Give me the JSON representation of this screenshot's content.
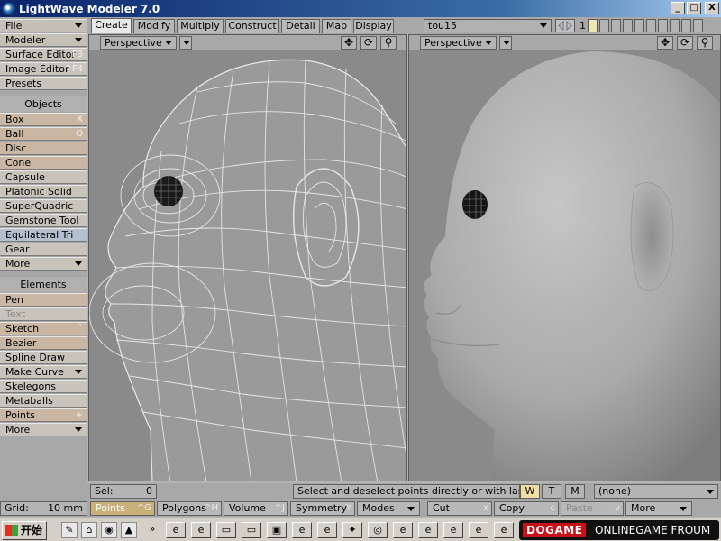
{
  "window": {
    "title": "LightWave Modeler 7.0",
    "controls": [
      "_",
      "□",
      "X"
    ]
  },
  "toolpanel": {
    "top_buttons": [
      {
        "label": "File",
        "shortcut": "",
        "dropdown": true,
        "style": "hdr"
      },
      {
        "label": "Modeler",
        "shortcut": "",
        "dropdown": true,
        "style": "hdr"
      },
      {
        "label": "Surface Editor",
        "shortcut": "F3",
        "dropdown": false,
        "style": ""
      },
      {
        "label": "Image Editor",
        "shortcut": "^F4",
        "dropdown": false,
        "style": ""
      },
      {
        "label": "Presets",
        "shortcut": "",
        "dropdown": false,
        "style": ""
      }
    ],
    "objects_header": "Objects",
    "objects": [
      {
        "label": "Box",
        "shortcut": "X",
        "dropdown": false,
        "style": "tan"
      },
      {
        "label": "Ball",
        "shortcut": "O",
        "dropdown": false,
        "style": "tan"
      },
      {
        "label": "Disc",
        "shortcut": "",
        "dropdown": false,
        "style": "tan"
      },
      {
        "label": "Cone",
        "shortcut": "",
        "dropdown": false,
        "style": "tan"
      },
      {
        "label": "Capsule",
        "shortcut": "",
        "dropdown": false,
        "style": ""
      },
      {
        "label": "Platonic Solid",
        "shortcut": "",
        "dropdown": false,
        "style": ""
      },
      {
        "label": "SuperQuadric",
        "shortcut": "",
        "dropdown": false,
        "style": ""
      },
      {
        "label": "Gemstone Tool",
        "shortcut": "",
        "dropdown": false,
        "style": ""
      },
      {
        "label": "Equilateral Tri",
        "shortcut": "",
        "dropdown": false,
        "style": "sel"
      },
      {
        "label": "Gear",
        "shortcut": "",
        "dropdown": false,
        "style": ""
      },
      {
        "label": "More",
        "shortcut": "",
        "dropdown": true,
        "style": ""
      }
    ],
    "elements_header": "Elements",
    "elements": [
      {
        "label": "Pen",
        "shortcut": "",
        "dropdown": false,
        "style": "tan"
      },
      {
        "label": "Text",
        "shortcut": "",
        "dropdown": false,
        "style": "dis"
      },
      {
        "label": "Sketch",
        "shortcut": "`",
        "dropdown": false,
        "style": "tan"
      },
      {
        "label": "Bezier",
        "shortcut": "",
        "dropdown": false,
        "style": "tan"
      },
      {
        "label": "Spline Draw",
        "shortcut": "",
        "dropdown": false,
        "style": ""
      },
      {
        "label": "Make Curve",
        "shortcut": "",
        "dropdown": true,
        "style": ""
      },
      {
        "label": "Skelegons",
        "shortcut": "",
        "dropdown": false,
        "style": ""
      },
      {
        "label": "Metaballs",
        "shortcut": "",
        "dropdown": false,
        "style": ""
      },
      {
        "label": "Points",
        "shortcut": "+",
        "dropdown": false,
        "style": "tan"
      },
      {
        "label": "More",
        "shortcut": "",
        "dropdown": true,
        "style": ""
      }
    ]
  },
  "tabs": [
    {
      "label": "Create",
      "active": true
    },
    {
      "label": "Modify",
      "active": false
    },
    {
      "label": "Multiply",
      "active": false
    },
    {
      "label": "Construct",
      "active": false
    },
    {
      "label": "Detail",
      "active": false
    },
    {
      "label": "Map",
      "active": false
    },
    {
      "label": "Display",
      "active": false
    }
  ],
  "object_selector": {
    "value": "tou15"
  },
  "layers": {
    "number": "1"
  },
  "viewports": [
    {
      "view": "Perspective",
      "mode": "wireframe"
    },
    {
      "view": "Perspective",
      "mode": "smooth-shaded"
    }
  ],
  "viewport_icons": [
    "move-view-icon",
    "rotate-view-icon",
    "zoom-view-icon"
  ],
  "statusbar": {
    "sel_label": "Sel:",
    "sel_value": "0",
    "info": "Select and deselect points directly or with lasso.",
    "wtm": [
      "W",
      "T",
      "M"
    ],
    "surface": "(none)"
  },
  "commandbar": {
    "grid_label": "Grid:",
    "grid_value": "10 mm",
    "buttons": [
      {
        "label": "Points",
        "shortcut": "^G",
        "style": "on",
        "dropdown": false
      },
      {
        "label": "Polygons",
        "shortcut": "^H",
        "style": "",
        "dropdown": false
      },
      {
        "label": "Volume",
        "shortcut": "^J",
        "style": "",
        "dropdown": false
      },
      {
        "label": "Symmetry",
        "shortcut": "Y",
        "style": "",
        "dropdown": false
      },
      {
        "label": "Modes",
        "shortcut": "",
        "style": "",
        "dropdown": true
      },
      {
        "label": "Cut",
        "shortcut": "x",
        "style": "",
        "dropdown": false
      },
      {
        "label": "Copy",
        "shortcut": "c",
        "style": "",
        "dropdown": false
      },
      {
        "label": "Paste",
        "shortcut": "v",
        "style": "dis",
        "dropdown": false
      },
      {
        "label": "More",
        "shortcut": "",
        "style": "",
        "dropdown": true
      }
    ]
  },
  "taskbar": {
    "start_label": "开始",
    "banner_logo": "DOGAME",
    "banner_text": "ONLINEGAME FROUM"
  },
  "colors": {
    "viewport_bg": "#8a8a8a",
    "wire": "#f0f0f0",
    "tan_button": "#c9b7a3",
    "active_toggle": "#c9b07a"
  }
}
